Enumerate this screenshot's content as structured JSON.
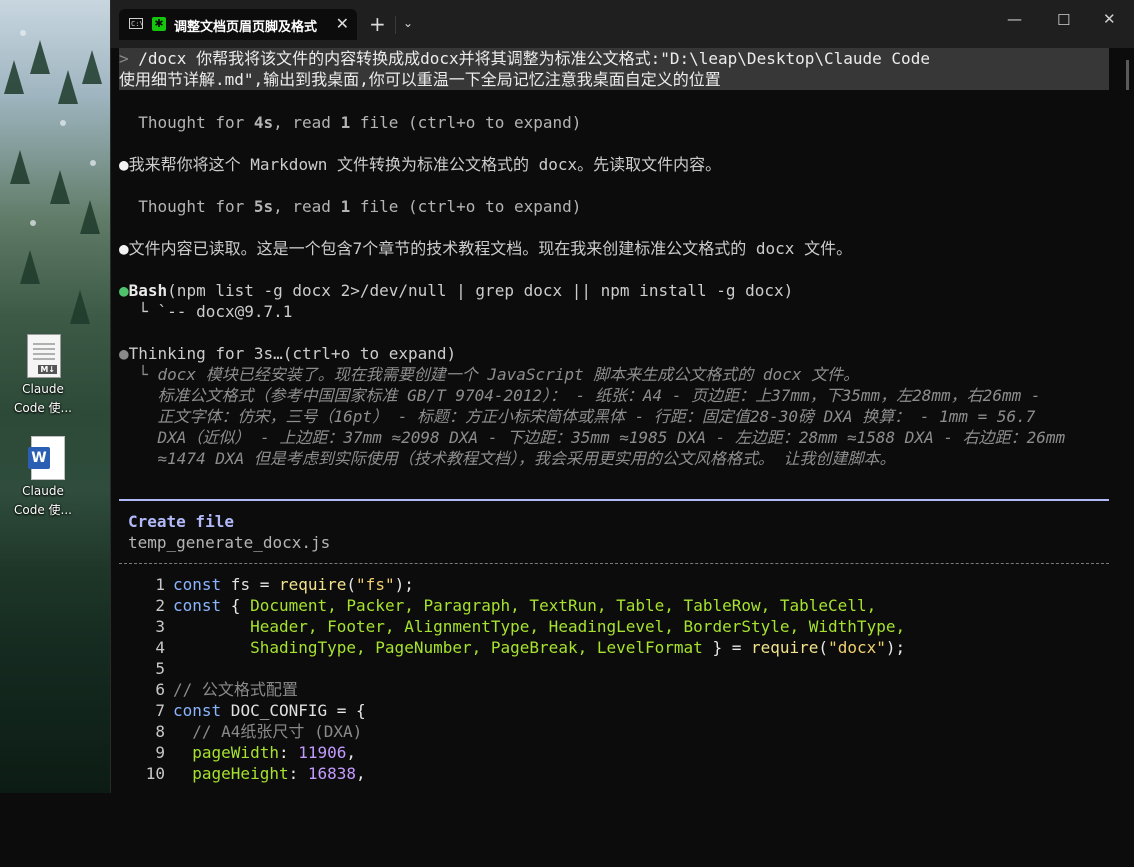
{
  "desktop": {
    "icons": [
      {
        "label_line1": "Claude",
        "label_line2": "Code 使..."
      },
      {
        "label_line1": "Claude",
        "label_line2": "Code 使..."
      }
    ]
  },
  "tab": {
    "title": "调整文档页眉页脚及格式",
    "close": "✕",
    "new_tab": "+",
    "dropdown": "⌄"
  },
  "window_controls": {
    "minimize": "—",
    "maximize": "☐",
    "close": "✕"
  },
  "prompt": {
    "marker": ">",
    "line1": " /docx 你帮我将该文件的内容转换成成docx并将其调整为标准公文格式:\"D:\\leap\\Desktop\\Claude Code",
    "line2": "使用细节详解.md\",输出到我桌面,你可以重温一下全局记忆注意我桌面自定义的位置"
  },
  "transcript": {
    "thought1": {
      "a": "  Thought for ",
      "b": "4s",
      "c": ", read ",
      "d": "1",
      "e": " file (ctrl+o to expand)"
    },
    "msg1": {
      "bullet": "●",
      "text": "我来帮你将这个 Markdown 文件转换为标准公文格式的 docx。先读取文件内容。"
    },
    "thought2": {
      "a": "  Thought for ",
      "b": "5s",
      "c": ", read ",
      "d": "1",
      "e": " file (ctrl+o to expand)"
    },
    "msg2": {
      "bullet": "●",
      "text": "文件内容已读取。这是一个包含7个章节的技术教程文档。现在我来创建标准公文格式的 docx 文件。"
    },
    "bash": {
      "bullet": "●",
      "name": "Bash",
      "cmd": "(npm list -g docx 2>/dev/null | grep docx || npm install -g docx)",
      "result": "  └ `-- docx@9.7.1"
    },
    "thinking": {
      "bullet": "●",
      "label": "Thinking for 3s…",
      "hint": "(ctrl+o to expand)",
      "lines": [
        "  └ docx 模块已经安装了。现在我需要创建一个 JavaScript 脚本来生成公文格式的 docx 文件。",
        "    标准公文格式（参考中国国家标准 GB/T 9704-2012）： - 纸张：A4 - 页边距：上37mm，下35mm，左28mm，右26mm -",
        "    正文字体：仿宋，三号（16pt） - 标题：方正小标宋简体或黑体 - 行距：固定值28-30磅 DXA 换算： - 1mm = 56.7",
        "    DXA（近似） - 上边距：37mm ≈2098 DXA - 下边距：35mm ≈1985 DXA - 左边距：28mm ≈1588 DXA - 右边距：26mm",
        "    ≈1474 DXA 但是考虑到实际使用（技术教程文档），我会采用更实用的公文风格格式。 让我创建脚本。"
      ]
    }
  },
  "create_file": {
    "title": "Create file",
    "filename": "temp_generate_docx.js"
  },
  "code": {
    "line_numbers": [
      "1",
      "2",
      "3",
      "4",
      "5",
      "6",
      "7",
      "8",
      "9",
      "10"
    ],
    "l1": {
      "kw": "const",
      "id": " fs ",
      "eq": "= ",
      "fn": "require",
      "p1": "(",
      "str": "\"fs\"",
      "p2": ");"
    },
    "l2": {
      "kw": "const",
      "p1": " { ",
      "items": "Document, Packer, Paragraph, TextRun, Table, TableRow, TableCell,"
    },
    "l3": {
      "items": "        Header, Footer, AlignmentType, HeadingLevel, BorderStyle, WidthType,"
    },
    "l4": {
      "items": "        ShadingType, PageNumber, PageBreak, LevelFormat",
      "p1": " } = ",
      "fn": "require",
      "p2": "(",
      "str": "\"docx\"",
      "p3": ");"
    },
    "l6": {
      "cm": "// 公文格式配置"
    },
    "l7": {
      "kw": "const",
      "id": " DOC_CONFIG ",
      "p": "= {"
    },
    "l8": {
      "cm": "  // A4纸张尺寸 (DXA)"
    },
    "l9": {
      "key": "  pageWidth",
      "p": ": ",
      "num": "11906",
      "end": ","
    },
    "l10": {
      "key": "  pageHeight",
      "p": ": ",
      "num": "16838",
      "end": ","
    }
  }
}
